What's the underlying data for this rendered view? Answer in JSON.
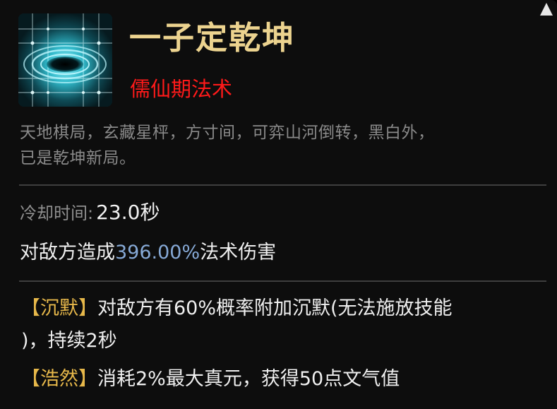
{
  "skill": {
    "icon_name": "go-board-vortex-icon",
    "title": "一子定乾坤",
    "subtitle": "儒仙期法术",
    "description_lines": [
      "天地棋局，玄藏星枰，方寸间，可弈山河倒转，黑白外，",
      "已是乾坤新局。"
    ],
    "cooldown_label": "冷却时间:",
    "cooldown_value": "23.0秒",
    "damage_prefix": "对敌方造成",
    "damage_percent": "396.00%",
    "damage_suffix": "法术伤害",
    "effects": [
      {
        "tag": "【沉默】",
        "text_line1": "对敌方有60%概率附加沉默(无法施放技能",
        "text_line2": ")，持续2秒"
      },
      {
        "tag": "【浩然】",
        "text_line1": "消耗2%最大真元，获得50点文气值"
      }
    ]
  },
  "colors": {
    "title": "#ecd38f",
    "subtitle": "#ff1a1a",
    "description": "#8a8a8a",
    "percent": "#86a9d6",
    "tag": "#e7b84a"
  }
}
